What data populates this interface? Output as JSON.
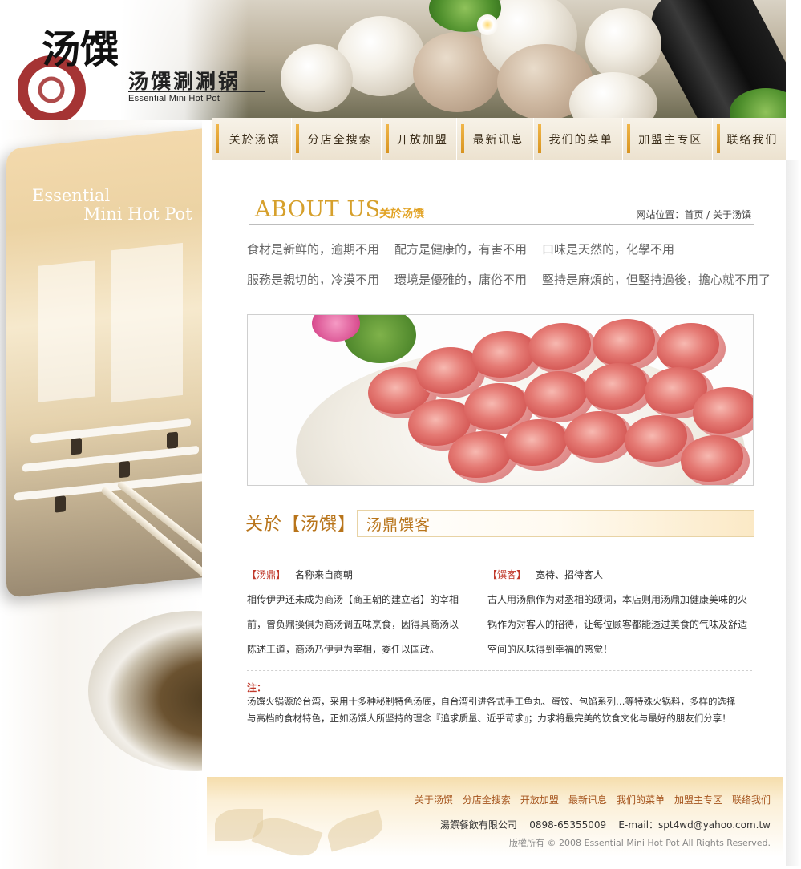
{
  "brand": {
    "logo_glyphs": "汤馔",
    "name_cn": "汤馔涮涮锅",
    "name_en": "Essential Mini Hot Pot"
  },
  "nav": {
    "items": [
      {
        "label": "关於汤馔"
      },
      {
        "label": "分店全搜索"
      },
      {
        "label": "开放加盟"
      },
      {
        "label": "最新讯息"
      },
      {
        "label": "我们的菜单"
      },
      {
        "label": "加盟主专区"
      },
      {
        "label": "联络我们"
      }
    ]
  },
  "left_panel": {
    "line1": "Essential",
    "line2": "Mini Hot Pot"
  },
  "page": {
    "heading_en": "ABOUT US",
    "heading_cn": "关於汤馔",
    "breadcrumb": "网站位置：首页 / 关于汤馔"
  },
  "mottos": [
    "食材是新鲜的，逾期不用",
    "配方是健康的，有害不用",
    "口味是天然的，化學不用",
    "服務是親切的，冷漠不用",
    "環境是優雅的，庸俗不用",
    "堅持是麻煩的，但堅持過後，擔心就不用了"
  ],
  "about": {
    "title": "关於【汤馔】",
    "subtitle": "汤鼎馔客",
    "left": {
      "tag": "【汤鼎】",
      "tag_desc": "名称来自商朝",
      "lines": [
        "相传伊尹还未成为商汤【商王朝的建立者】的宰相",
        "前，曾负鼎操俱为商汤调五味烹食，因得具商汤以",
        "陈述王道，商汤乃伊尹为宰相，委任以国政。"
      ]
    },
    "right": {
      "tag": "【馔客】",
      "tag_desc": "宽待、招待客人",
      "lines": [
        "古人用汤鼎作为对丞相的颂词，本店则用汤鼎加健康美味的火",
        "锅作为对客人的招待，让每位顾客都能透过美食的气味及舒适",
        "空间的风味得到幸福的感觉！"
      ]
    },
    "note_label": "注：",
    "note_lines": [
      "汤馔火锅源於台湾，采用十多种秘制特色汤底，自台湾引进各式手工鱼丸、蛋饺、包馅系列…等特殊火锅料，多样的选择",
      "与高档的食材特色，正如汤馔人所坚持的理念『追求质量、近乎苛求』；力求将最完美的饮食文化与最好的朋友们分享！"
    ]
  },
  "footer": {
    "links": [
      "关于汤馔",
      "分店全搜索",
      "开放加盟",
      "最新讯息",
      "我们的菜单",
      "加盟主专区",
      "联络我们"
    ],
    "company": "湯饌餐飲有限公司",
    "phone": "0898-65355009",
    "email_label": "E-mail：",
    "email": "spt4wd@yahoo.com.tw",
    "copyright": "版權所有 © 2008 Essential Mini Hot Pot  All Rights Reserved."
  },
  "colors": {
    "accent_gold": "#d6a02c",
    "accent_brown": "#b8741a",
    "tag_red": "#c0392b",
    "footer_link": "#a5541c"
  }
}
